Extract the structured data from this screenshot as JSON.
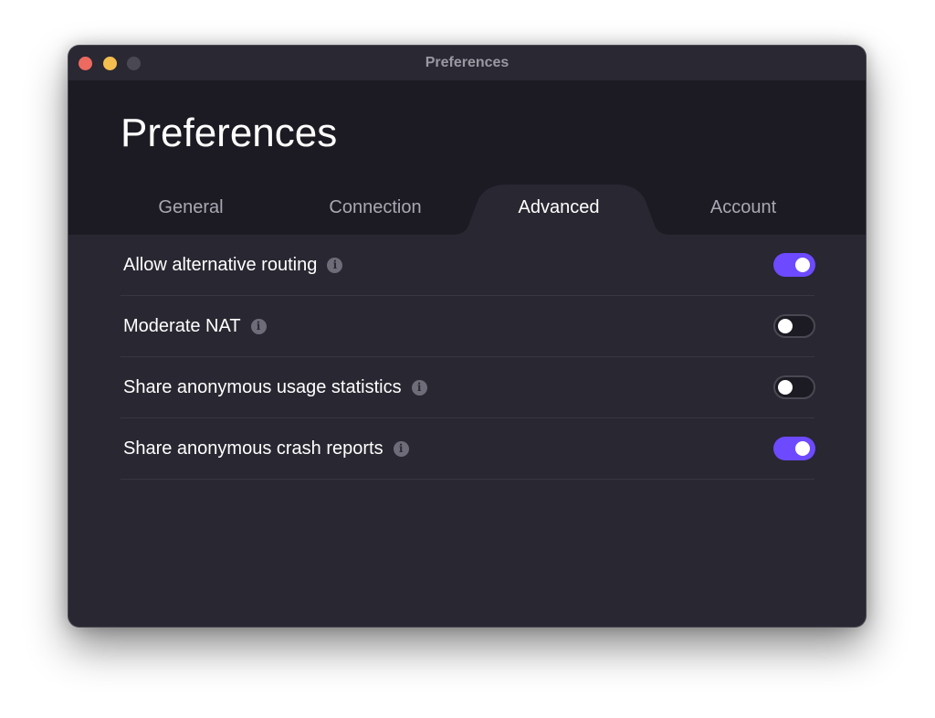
{
  "window": {
    "title": "Preferences",
    "traffic_lights": [
      {
        "name": "close",
        "color": "#ec6a5f"
      },
      {
        "name": "minimize",
        "color": "#f4bf4f"
      },
      {
        "name": "zoom",
        "color": "#4a4852"
      }
    ]
  },
  "header": {
    "title": "Preferences"
  },
  "tabs": [
    {
      "label": "General",
      "active": false
    },
    {
      "label": "Connection",
      "active": false
    },
    {
      "label": "Advanced",
      "active": true
    },
    {
      "label": "Account",
      "active": false
    }
  ],
  "settings": [
    {
      "label": "Allow alternative routing",
      "icon": "info-icon",
      "info_glyph": "i",
      "enabled": true
    },
    {
      "label": "Moderate NAT",
      "icon": "info-icon",
      "info_glyph": "i",
      "enabled": false
    },
    {
      "label": "Share anonymous usage statistics",
      "icon": "info-icon",
      "info_glyph": "i",
      "enabled": false
    },
    {
      "label": "Share anonymous crash reports",
      "icon": "info-icon",
      "info_glyph": "i",
      "enabled": true
    }
  ],
  "colors": {
    "accent": "#6d4aff",
    "header_bg": "#1c1b23",
    "content_bg": "#292731",
    "titlebar_bg": "#2a2833"
  }
}
